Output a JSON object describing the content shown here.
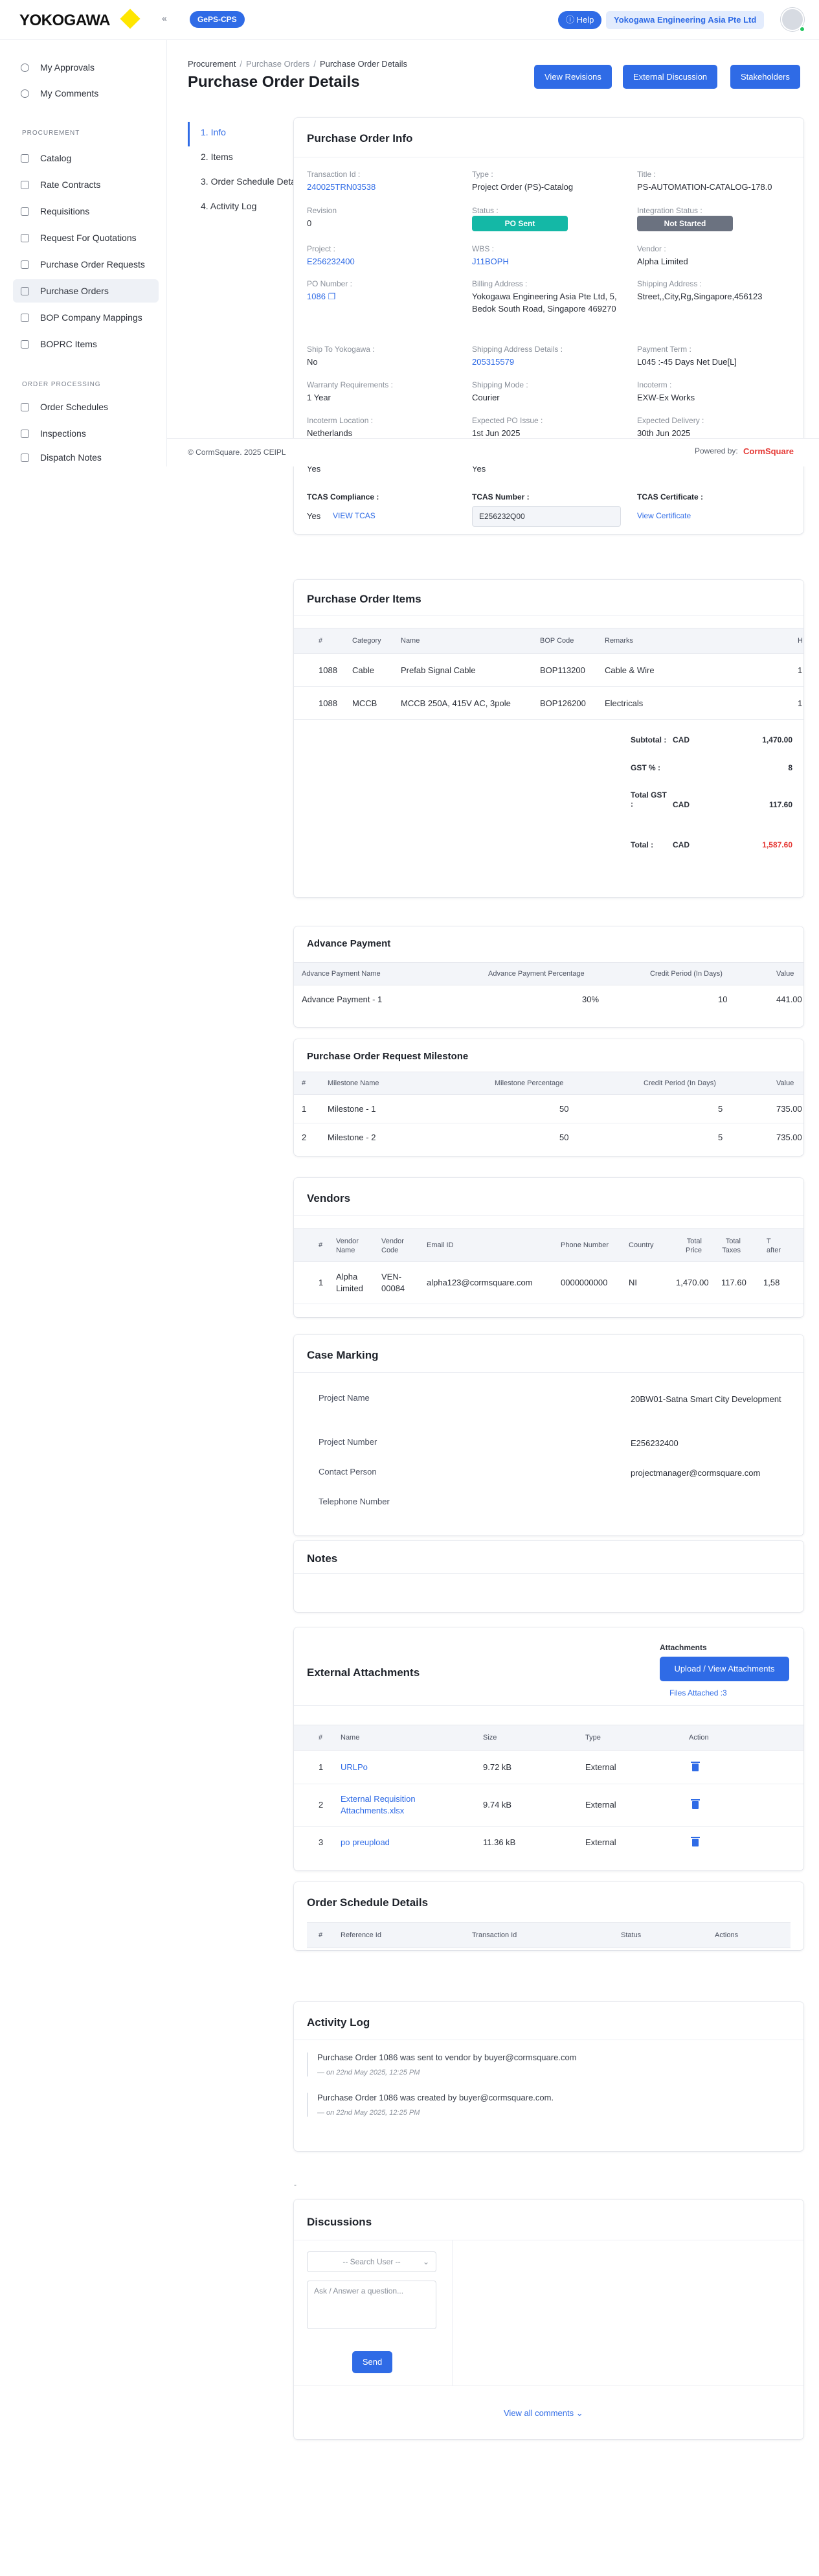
{
  "topbar": {
    "logo": "YOKOGAWA",
    "collapse_icon": "«",
    "app_badge": "GePS-CPS",
    "help_label": "Help",
    "company": "Yokogawa Engineering Asia Pte Ltd"
  },
  "sidebar": {
    "top_items": [
      {
        "label": "My Approvals",
        "icon": "clock-icon"
      },
      {
        "label": "My Comments",
        "icon": "comment-icon"
      }
    ],
    "procurement_header": "PROCUREMENT",
    "procurement_items": [
      {
        "label": "Catalog",
        "icon": "catalog-icon"
      },
      {
        "label": "Rate Contracts",
        "icon": "contract-icon"
      },
      {
        "label": "Requisitions",
        "icon": "document-icon"
      },
      {
        "label": "Request For Quotations",
        "icon": "document-icon"
      },
      {
        "label": "Purchase Order Requests",
        "icon": "document-icon"
      },
      {
        "label": "Purchase Orders",
        "icon": "document-icon",
        "active": true
      },
      {
        "label": "BOP Company Mappings",
        "icon": "mapping-icon"
      },
      {
        "label": "BOPRC Items",
        "icon": "document-icon"
      }
    ],
    "order_header": "ORDER PROCESSING",
    "order_items": [
      {
        "label": "Order Schedules",
        "icon": "calendar-icon"
      },
      {
        "label": "Inspections",
        "icon": "inspection-icon"
      },
      {
        "label": "Dispatch Notes",
        "icon": "document-icon"
      }
    ]
  },
  "breadcrumb": [
    "Procurement",
    "Purchase Orders",
    "Purchase Order Details"
  ],
  "page_title": "Purchase Order Details",
  "header_buttons": {
    "revisions": "View Revisions",
    "discussion": "External Discussion",
    "stakeholders": "Stakeholders"
  },
  "anchors": [
    "1. Info",
    "2. Items",
    "3. Order Schedule Details",
    "4. Activity Log"
  ],
  "po_info": {
    "title": "Purchase Order Info",
    "fields": {
      "transaction_id": {
        "label": "Transaction Id :",
        "value": "240025TRN03538"
      },
      "type": {
        "label": "Type :",
        "value": "Project Order (PS)-Catalog"
      },
      "title": {
        "label": "Title :",
        "value": "PS-AUTOMATION-CATALOG-178.0"
      },
      "revision": {
        "label": "Revision",
        "value": "0"
      },
      "status": {
        "label": "Status :",
        "value": "PO Sent"
      },
      "integration_status": {
        "label": "Integration Status :",
        "value": "Not Started"
      },
      "project": {
        "label": "Project :",
        "value": "E256232400"
      },
      "wbs": {
        "label": "WBS :",
        "value": "J11BOPH"
      },
      "vendor": {
        "label": "Vendor :",
        "value": "Alpha Limited"
      },
      "po_number": {
        "label": "PO Number :",
        "value": "1086"
      },
      "billing_address": {
        "label": "Billing Address :",
        "value": "Yokogawa Engineering Asia Pte Ltd, 5, Bedok South Road, Singapore 469270"
      },
      "shipping_address": {
        "label": "Shipping Address :",
        "value": "Street,,City,Rg,Singapore,456123"
      },
      "ship_to_yokogawa": {
        "label": "Ship To Yokogawa :",
        "value": "No"
      },
      "shipping_address_details": {
        "label": "Shipping Address Details :",
        "value": "205315579"
      },
      "payment_term": {
        "label": "Payment Term :",
        "value": "L045 :-45 Days Net Due[L]"
      },
      "warranty": {
        "label": "Warranty Requirements :",
        "value": "1 Year"
      },
      "shipping_mode": {
        "label": "Shipping Mode :",
        "value": "Courier"
      },
      "incoterm": {
        "label": "Incoterm :",
        "value": "EXW-Ex Works"
      },
      "incoterm_location": {
        "label": "Incoterm Location :",
        "value": "Netherlands"
      },
      "expected_po_issue": {
        "label": "Expected PO Issue :",
        "value": "1st Jun 2025"
      },
      "expected_delivery": {
        "label": "Expected Delivery :",
        "value": "30th Jun 2025"
      },
      "extra_1": "Yes",
      "extra_2": "Yes",
      "tcas_compliance": {
        "label": "TCAS Compliance :",
        "value": "Yes",
        "link": "VIEW TCAS"
      },
      "tcas_number": {
        "label": "TCAS Number :",
        "value": "E256232Q00"
      },
      "tcas_certificate": {
        "label": "TCAS Certificate :",
        "link": "View Certificate"
      }
    },
    "status_color": "#14b8a6",
    "integration_color": "#6b7280"
  },
  "footer": {
    "copyright": "© CormSquare. 2025 CEIPL",
    "powered": "Powered by:",
    "brand": "CormSquare"
  },
  "items": {
    "title": "Purchase Order Items",
    "headers": [
      "#",
      "Category",
      "Name",
      "BOP Code",
      "Remarks",
      "H"
    ],
    "rows": [
      {
        "no": "1088",
        "category": "Cable",
        "name": "Prefab Signal Cable",
        "bop": "BOP113200",
        "remarks": "Cable & Wire",
        "h": "1"
      },
      {
        "no": "1088",
        "category": "MCCB",
        "name": "MCCB 250A, 415V AC, 3pole",
        "bop": "BOP126200",
        "remarks": "Electricals",
        "h": "1"
      }
    ],
    "subtotal_label": "Subtotal :",
    "subtotal_cur": "CAD",
    "subtotal": "1,470.00",
    "gst_label": "GST % :",
    "gst": "8",
    "total_gst_label": "Total GST :",
    "total_gst_cur": "CAD",
    "total_gst": "117.60",
    "total_label": "Total :",
    "total_cur": "CAD",
    "total": "1,587.60",
    "total_color": "#e53935"
  },
  "advance_payment": {
    "title": "Advance Payment",
    "headers": [
      "Advance Payment Name",
      "Advance Payment Percentage",
      "Credit Period (In Days)",
      "Value"
    ],
    "rows": [
      {
        "name": "Advance Payment - 1",
        "pct": "30%",
        "credit": "10",
        "value": "441.00"
      }
    ]
  },
  "milestones": {
    "title": "Purchase Order Request Milestone",
    "headers": [
      "#",
      "Milestone Name",
      "Milestone Percentage",
      "Credit Period (In Days)",
      "Value"
    ],
    "rows": [
      {
        "no": "1",
        "name": "Milestone - 1",
        "pct": "50",
        "credit": "5",
        "value": "735.00"
      },
      {
        "no": "2",
        "name": "Milestone - 2",
        "pct": "50",
        "credit": "5",
        "value": "735.00"
      }
    ]
  },
  "vendors": {
    "title": "Vendors",
    "headers": [
      "#",
      "Vendor Name",
      "Vendor Code",
      "Email ID",
      "Phone Number",
      "Country",
      "Total Price",
      "Total Taxes",
      "T after"
    ],
    "rows": [
      {
        "no": "1",
        "name": "Alpha Limited",
        "code": "VEN-00084",
        "email": "alpha123@cormsquare.com",
        "phone": "0000000000",
        "country": "NI",
        "price": "1,470.00",
        "taxes": "117.60",
        "after": "1,58"
      }
    ]
  },
  "case_marking": {
    "title": "Case Marking",
    "rows": [
      {
        "label": "Project Name",
        "value": "20BW01-Satna Smart City Development"
      },
      {
        "label": "Project Number",
        "value": "E256232400"
      },
      {
        "label": "Contact Person",
        "value": "projectmanager@cormsquare.com"
      },
      {
        "label": "Telephone Number",
        "value": ""
      }
    ]
  },
  "notes": {
    "title": "Notes"
  },
  "attachments": {
    "title": "External Attachments",
    "side_label": "Attachments",
    "upload_button": "Upload / View Attachments",
    "files_attached": "Files Attached :3",
    "headers": [
      "#",
      "Name",
      "Size",
      "Type",
      "Action"
    ],
    "rows": [
      {
        "no": "1",
        "name": "URLPo",
        "size": "9.72 kB",
        "type": "External"
      },
      {
        "no": "2",
        "name": "External Requisition Attachments.xlsx",
        "size": "9.74 kB",
        "type": "External"
      },
      {
        "no": "3",
        "name": "po preupload",
        "size": "11.36 kB",
        "type": "External"
      }
    ]
  },
  "order_schedule": {
    "title": "Order Schedule Details",
    "headers": [
      "#",
      "Reference Id",
      "Transaction Id",
      "Status",
      "Actions"
    ]
  },
  "activity": {
    "title": "Activity Log",
    "entries": [
      {
        "text": "Purchase Order 1086 was sent to vendor by buyer@cormsquare.com",
        "time": "— on 22nd May 2025, 12:25 PM"
      },
      {
        "text": "Purchase Order 1086 was created by buyer@cormsquare.com.",
        "time": "— on 22nd May 2025, 12:25 PM"
      }
    ]
  },
  "discussions": {
    "title": "Discussions",
    "user_select": "-- Search User --",
    "question_placeholder": "Ask / Answer a question...",
    "send_button": "Send",
    "view_all": "View all comments"
  },
  "stray_mark": "-"
}
